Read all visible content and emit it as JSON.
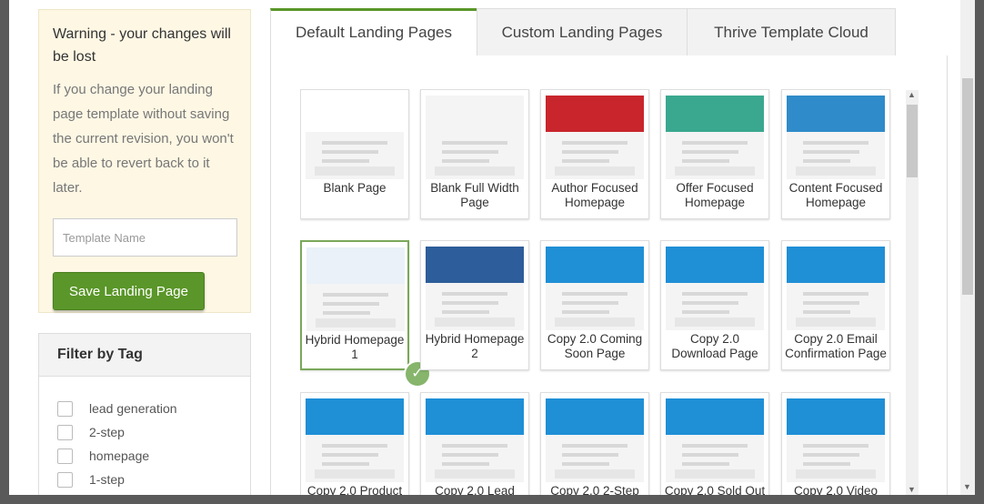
{
  "warning": {
    "title": "Warning - your changes will be lost",
    "text": "If you change your landing page template without saving the current revision, you won't be able to revert back to it later."
  },
  "template_input": {
    "placeholder": "Template Name",
    "value": ""
  },
  "save_button": {
    "label": "Save Landing Page"
  },
  "filter": {
    "title": "Filter by Tag",
    "tags": [
      "lead generation",
      "2-step",
      "homepage",
      "1-step"
    ]
  },
  "tabs": [
    {
      "label": "Default Landing Pages",
      "active": true
    },
    {
      "label": "Custom Landing Pages",
      "active": false
    },
    {
      "label": "Thrive Template Cloud",
      "active": false
    }
  ],
  "templates": [
    {
      "label": "Blank Page",
      "selected": false,
      "hero_color": "#ffffff"
    },
    {
      "label": "Blank Full Width Page",
      "selected": false,
      "hero_color": "#f4f4f4"
    },
    {
      "label": "Author Focused Homepage",
      "selected": false,
      "hero_color": "#c9252c"
    },
    {
      "label": "Offer Focused Homepage",
      "selected": false,
      "hero_color": "#3aa88f"
    },
    {
      "label": "Content Focused Homepage",
      "selected": false,
      "hero_color": "#2f8bc9"
    },
    {
      "label": "Hybrid Homepage 1",
      "selected": true,
      "hero_color": "#eaf1f8"
    },
    {
      "label": "Hybrid Homepage 2",
      "selected": false,
      "hero_color": "#2d5d9a"
    },
    {
      "label": "Copy 2.0 Coming Soon Page",
      "selected": false,
      "hero_color": "#1f8fd6"
    },
    {
      "label": "Copy 2.0 Download Page",
      "selected": false,
      "hero_color": "#1f8fd6"
    },
    {
      "label": "Copy 2.0 Email Confirmation Page",
      "selected": false,
      "hero_color": "#1f8fd6"
    },
    {
      "label": "Copy 2.0 Product",
      "selected": false,
      "hero_color": "#1f8fd6"
    },
    {
      "label": "Copy 2.0 Lead",
      "selected": false,
      "hero_color": "#1f8fd6"
    },
    {
      "label": "Copy 2.0 2-Step",
      "selected": false,
      "hero_color": "#1f8fd6"
    },
    {
      "label": "Copy 2.0 Sold Out",
      "selected": false,
      "hero_color": "#1f8fd6"
    },
    {
      "label": "Copy 2.0 Video",
      "selected": false,
      "hero_color": "#1f8fd6"
    }
  ],
  "selected_icon": "checkmark-icon",
  "colors": {
    "accent": "#5a9629",
    "warning_bg": "#fdf7e4"
  }
}
